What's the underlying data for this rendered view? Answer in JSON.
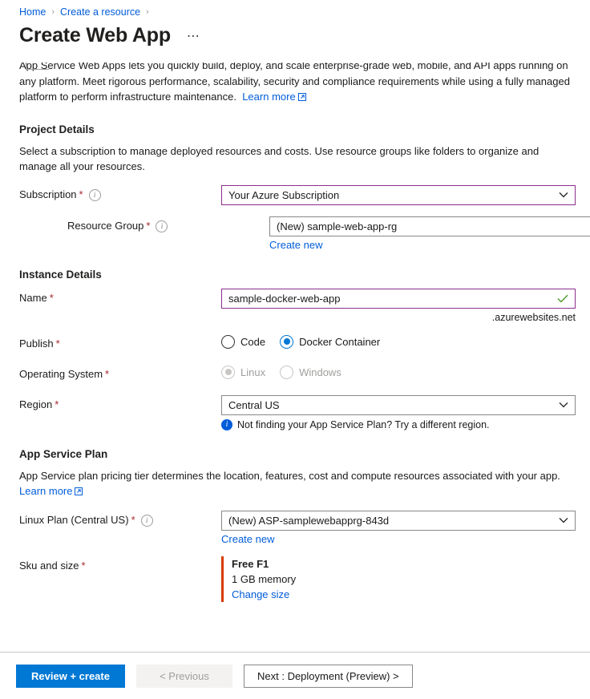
{
  "breadcrumb": {
    "items": [
      {
        "label": "Home"
      },
      {
        "label": "Create a resource"
      }
    ],
    "separator": "›"
  },
  "header": {
    "title": "Create Web App",
    "ellipsis": "⋯"
  },
  "intro": {
    "text": "App Service Web Apps lets you quickly build, deploy, and scale enterprise-grade web, mobile, and API apps running on any platform. Meet rigorous performance, scalability, security and compliance requirements while using a fully managed platform to perform infrastructure maintenance.",
    "learn_more": "Learn more"
  },
  "project_details": {
    "heading": "Project Details",
    "description": "Select a subscription to manage deployed resources and costs. Use resource groups like folders to organize and manage all your resources.",
    "subscription": {
      "label": "Subscription",
      "required": "*",
      "value": "Your Azure Subscription",
      "focused": true
    },
    "resource_group": {
      "label": "Resource Group",
      "required": "*",
      "value": "(New) sample-web-app-rg",
      "create_new": "Create new"
    }
  },
  "instance_details": {
    "heading": "Instance Details",
    "name": {
      "label": "Name",
      "required": "*",
      "value": "sample-docker-web-app",
      "suffix": ".azurewebsites.net",
      "valid": true
    },
    "publish": {
      "label": "Publish",
      "required": "*",
      "options": [
        {
          "label": "Code",
          "selected": false,
          "disabled": false
        },
        {
          "label": "Docker Container",
          "selected": true,
          "disabled": false
        }
      ]
    },
    "operating_system": {
      "label": "Operating System",
      "required": "*",
      "options": [
        {
          "label": "Linux",
          "selected": true,
          "disabled": true
        },
        {
          "label": "Windows",
          "selected": false,
          "disabled": true
        }
      ]
    },
    "region": {
      "label": "Region",
      "required": "*",
      "value": "Central US",
      "note": "Not finding your App Service Plan? Try a different region."
    }
  },
  "app_service_plan": {
    "heading": "App Service Plan",
    "description": "App Service plan pricing tier determines the location, features, cost and compute resources associated with your app.",
    "learn_more": "Learn more",
    "linux_plan": {
      "label": "Linux Plan (Central US)",
      "required": "*",
      "value": "(New) ASP-samplewebapprg-843d",
      "create_new": "Create new"
    },
    "sku": {
      "label": "Sku and size",
      "required": "*",
      "title": "Free F1",
      "memory": "1 GB memory",
      "change": "Change size",
      "accent_color": "#d83b01"
    }
  },
  "footer": {
    "review_create": "Review + create",
    "previous": "< Previous",
    "next": "Next : Deployment (Preview) >"
  },
  "colors": {
    "accent": "#0078d4",
    "link": "#015cda",
    "required": "#a4262c",
    "focus_border": "#8c2f8c",
    "valid": "#5a9e3a"
  }
}
